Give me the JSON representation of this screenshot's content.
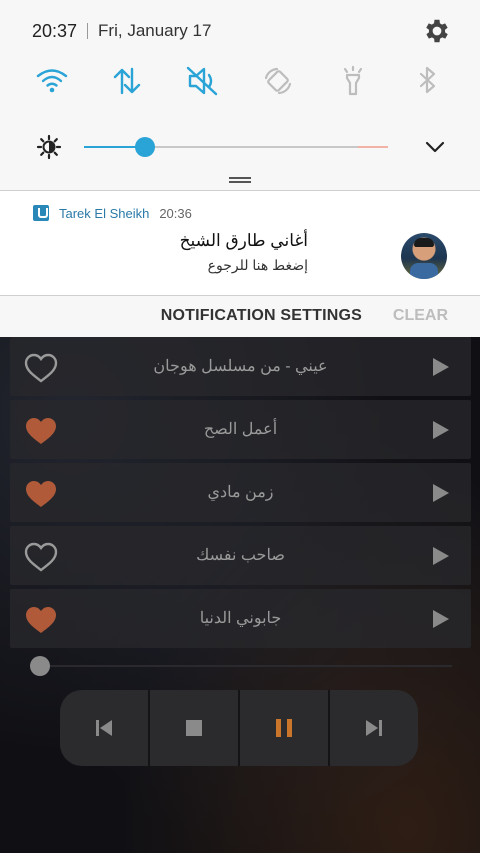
{
  "status": {
    "time": "20:37",
    "date": "Fri, January 17"
  },
  "quick_settings": [
    {
      "icon": "wifi-icon",
      "active": true
    },
    {
      "icon": "mobile-data-icon",
      "active": true
    },
    {
      "icon": "mute-icon",
      "active": true
    },
    {
      "icon": "auto-rotate-icon",
      "active": false
    },
    {
      "icon": "flashlight-icon",
      "active": false
    },
    {
      "icon": "bluetooth-icon",
      "active": false
    }
  ],
  "brightness": {
    "level": 0.2
  },
  "notification": {
    "app": "Tarek El Sheikh",
    "time": "20:36",
    "title": "أغاني طارق الشيخ",
    "text": "إضغط هنا للرجوع"
  },
  "shade_actions": {
    "settings": "NOTIFICATION SETTINGS",
    "clear": "CLEAR"
  },
  "songs": [
    {
      "title": "عيني - من مسلسل هوجان",
      "favorite": false
    },
    {
      "title": "أعمل الصح",
      "favorite": true
    },
    {
      "title": "زمن مادي",
      "favorite": true
    },
    {
      "title": "صاحب نفسك",
      "favorite": false
    },
    {
      "title": "جابوني الدنيا",
      "favorite": true
    }
  ],
  "player": {
    "progress": 0.0
  },
  "colors": {
    "accent": "#2aa3d6",
    "heart_fav": "#b05a3a",
    "pause": "#c9762a"
  }
}
